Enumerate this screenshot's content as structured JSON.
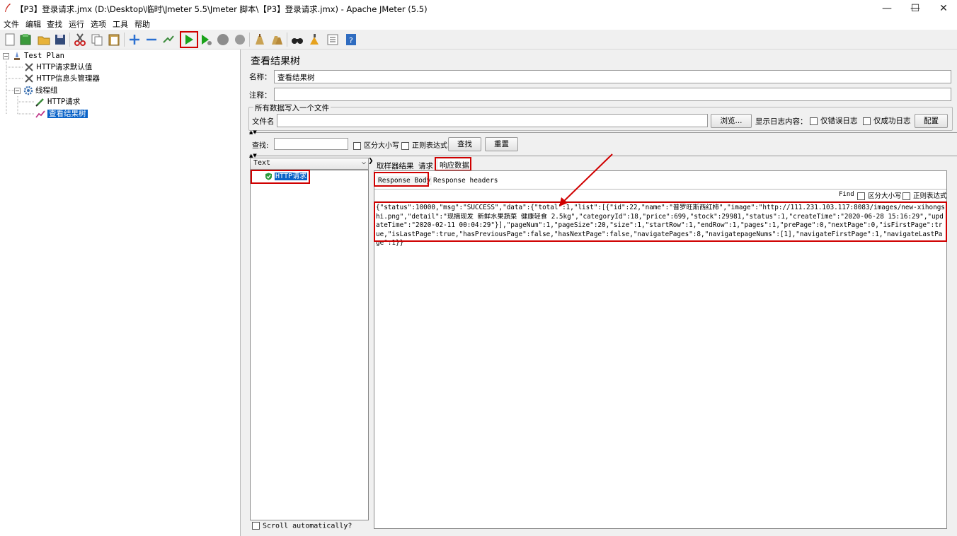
{
  "window": {
    "title": "【P3】登录请求.jmx (D:\\Desktop\\临时\\Jmeter 5.5\\Jmeter 脚本\\【P3】登录请求.jmx) - Apache JMeter (5.5)",
    "minimize": "—",
    "maximize": "☐",
    "close": "✕"
  },
  "menu": [
    "文件",
    "编辑",
    "查找",
    "运行",
    "选项",
    "工具",
    "帮助"
  ],
  "tree": {
    "root": "Test Plan",
    "items": [
      "HTTP请求默认值",
      "HTTP信息头管理器",
      "线程组",
      "HTTP请求",
      "查看结果树"
    ]
  },
  "panel": {
    "title": "查看结果树",
    "name_label": "名称：",
    "name_value": "查看结果树",
    "comment_label": "注释：",
    "comment_value": "",
    "file_group": "所有数据写入一个文件",
    "filename_label": "文件名",
    "filename_value": "",
    "browse": "浏览...",
    "log_label": "显示日志内容：",
    "errors_only": "仅错误日志",
    "success_only": "仅成功日志",
    "configure": "配置"
  },
  "search": {
    "label": "查找:",
    "value": "",
    "case_sensitive": "区分大小写",
    "regex": "正则表达式",
    "find": "查找",
    "reset": "重置"
  },
  "results": {
    "renderer": "Text",
    "sample": "HTTP请求",
    "scroll_auto": "Scroll automatically?"
  },
  "tabs": [
    "取样器结果",
    "请求",
    "响应数据"
  ],
  "subtabs": [
    "Response Body",
    "Response headers"
  ],
  "find_bar": {
    "find": "Find",
    "case_sensitive": "区分大小写",
    "regex": "正则表达式"
  },
  "response_body": "{\"status\":10000,\"msg\":\"SUCCESS\",\"data\":{\"total\":1,\"list\":[{\"id\":22,\"name\":\"普罗旺斯西红柿\",\"image\":\"http://111.231.103.117:8083/images/new-xihongshi.png\",\"detail\":\"现摘现发 新鲜水果蔬菜 健康轻食 2.5kg\",\"categoryId\":18,\"price\":699,\"stock\":29981,\"status\":1,\"createTime\":\"2020-06-28 15:16:29\",\"updateTime\":\"2020-02-11 00:04:29\"}],\"pageNum\":1,\"pageSize\":20,\"size\":1,\"startRow\":1,\"endRow\":1,\"pages\":1,\"prePage\":0,\"nextPage\":0,\"isFirstPage\":true,\"isLastPage\":true,\"hasPreviousPage\":false,\"hasNextPage\":false,\"navigatePages\":8,\"navigatepageNums\":[1],\"navigateFirstPage\":1,\"navigateLastPage\":1}}",
  "colors": {
    "highlight": "#d00000",
    "selection": "#0a63c8",
    "run_green": "#1aa31a"
  }
}
